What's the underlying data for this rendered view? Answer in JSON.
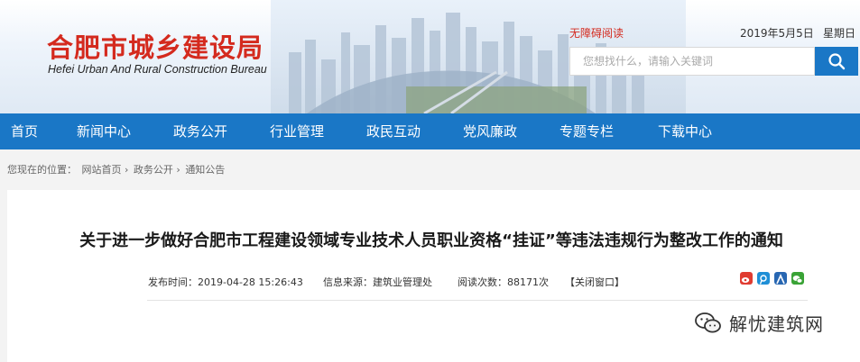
{
  "header": {
    "logo_cn": "合肥市城乡建设局",
    "logo_en": "Hefei Urban And Rural Construction Bureau",
    "accessible_read": "无障碍阅读",
    "date": "2019年5月5日",
    "weekday": "星期日",
    "search_placeholder": "您想找什么，请输入关键词"
  },
  "nav": {
    "items": [
      {
        "label": "首页"
      },
      {
        "label": "新闻中心"
      },
      {
        "label": "政务公开"
      },
      {
        "label": "行业管理"
      },
      {
        "label": "政民互动"
      },
      {
        "label": "党风廉政"
      },
      {
        "label": "专题专栏"
      },
      {
        "label": "下载中心"
      }
    ]
  },
  "breadcrumb": {
    "prefix": "您现在的位置：",
    "items": [
      "网站首页",
      "政务公开",
      "通知公告"
    ],
    "separator": "›"
  },
  "article": {
    "title": "关于进一步做好合肥市工程建设领域专业技术人员职业资格“挂证”等违法违规行为整改工作的通知",
    "publish_time": "发布时间：2019-04-28 15:26:43",
    "source": "信息来源：建筑业管理处",
    "views": "阅读次数：88171次",
    "close_window": "【关闭窗口】",
    "share_icons": [
      "weibo-icon",
      "tencent-weibo-icon",
      "renren-icon",
      "wechat-icon"
    ]
  },
  "watermark": {
    "text": "解忧建筑网"
  },
  "colors": {
    "brand_blue": "#1a77c6",
    "logo_red": "#d42a1e"
  }
}
